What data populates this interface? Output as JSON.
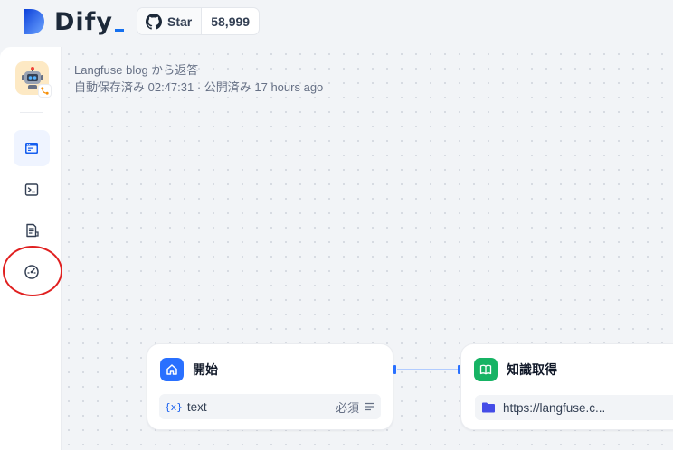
{
  "header": {
    "logo_text": "Dify",
    "github": {
      "star_label": "Star",
      "star_count": "58,999"
    }
  },
  "sidebar": {
    "items": [
      {
        "name": "app-overview",
        "icon": "window-icon",
        "active": true
      },
      {
        "name": "logs",
        "icon": "terminal-icon",
        "active": false
      },
      {
        "name": "annotations",
        "icon": "document-icon",
        "active": false
      },
      {
        "name": "monitoring",
        "icon": "gauge-icon",
        "active": false
      }
    ]
  },
  "app": {
    "title": "Langfuse blog から返答",
    "status": "自動保存済み 02:47:31 · 公開済み 17 hours ago"
  },
  "nodes": {
    "start": {
      "title": "開始",
      "variable": "text",
      "required_label": "必須",
      "var_glyph": "{x}"
    },
    "knowledge": {
      "title": "知識取得",
      "dataset": "https://langfuse.c..."
    }
  },
  "colors": {
    "accent_blue": "#2970ff",
    "knowledge_green": "#16b364",
    "annotation_red": "#e02020"
  }
}
